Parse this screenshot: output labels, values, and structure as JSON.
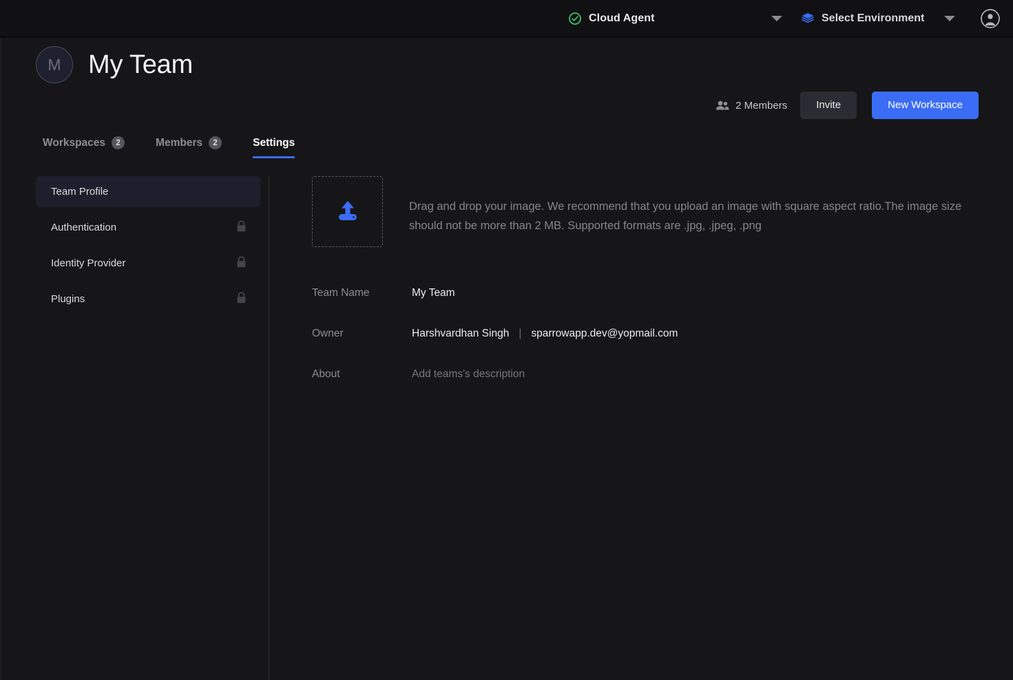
{
  "topbar": {
    "agent_status_icon": "check-circle-icon",
    "agent_label": "Cloud Agent",
    "agent_caret_icon": "chevron-down-icon",
    "environment_icon": "layers-icon",
    "environment_label": "Select Environment",
    "environment_caret_icon": "chevron-down-icon",
    "account_icon": "account-circle-icon"
  },
  "team": {
    "avatar_initial": "M",
    "title": "My Team",
    "members_icon": "people-icon",
    "members_count_label": "2 Members",
    "invite_label": "Invite",
    "new_workspace_label": "New Workspace"
  },
  "tabs": [
    {
      "label": "Workspaces",
      "badge": "2",
      "active": false
    },
    {
      "label": "Members",
      "badge": "2",
      "active": false
    },
    {
      "label": "Settings",
      "badge": "",
      "active": true
    }
  ],
  "sidenav": {
    "items": [
      {
        "label": "Team Profile",
        "locked": false,
        "active": true
      },
      {
        "label": "Authentication",
        "locked": true,
        "active": false
      },
      {
        "label": "Identity Provider",
        "locked": true,
        "active": false
      },
      {
        "label": "Plugins",
        "locked": true,
        "active": false
      }
    ],
    "lock_icon": "lock-icon"
  },
  "profile": {
    "upload_icon": "upload-icon",
    "upload_help": "Drag and drop your image. We recommend that you upload an image with square aspect ratio.The image size should not be more than 2 MB. Supported formats are .jpg, .jpeg, .png",
    "fields": {
      "team_name_label": "Team Name",
      "team_name_value": "My Team",
      "owner_label": "Owner",
      "owner_name": "Harshvardhan Singh",
      "owner_separator": "|",
      "owner_email": "sparrowapp.dev@yopmail.com",
      "about_label": "About",
      "about_placeholder": "Add teams's description"
    }
  },
  "colors": {
    "accent_blue": "#3b6cf6",
    "status_green": "#3ec46d",
    "page_bg": "#161618",
    "topbar_bg": "#111113"
  }
}
